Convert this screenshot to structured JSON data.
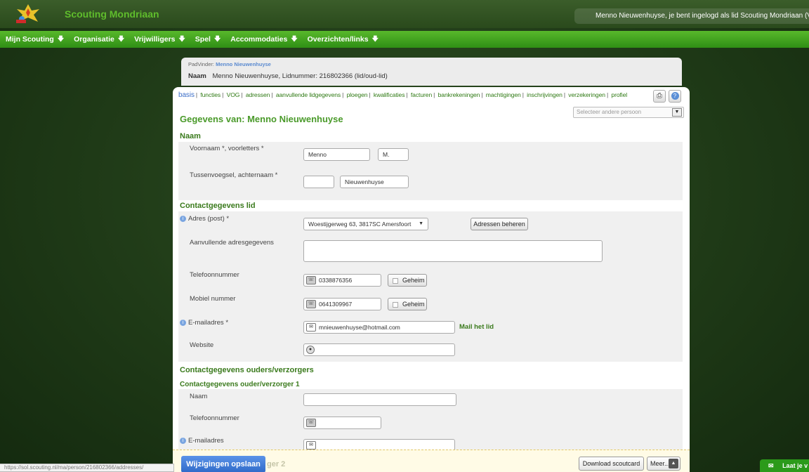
{
  "header": {
    "brand": "Scouting Mondriaan",
    "login_text": "Menno Nieuwenhuyse, je bent ingelogd als lid Scouting Mondriaan (Vrienden"
  },
  "nav": {
    "items": [
      {
        "label": "Mijn Scouting"
      },
      {
        "label": "Organisatie"
      },
      {
        "label": "Vrijwilligers"
      },
      {
        "label": "Spel"
      },
      {
        "label": "Accommodaties"
      },
      {
        "label": "Overzichten/links"
      }
    ]
  },
  "person": {
    "padvinder_label": "PadVinder:",
    "padvinder_name": "Menno Nieuwenhuyse",
    "naam_label": "Naam",
    "naam_value": "Menno Nieuwenhuyse, Lidnummer: 216802366 (lid/oud-lid)"
  },
  "tabs": [
    "basis",
    "functies",
    "VOG",
    "adressen",
    "aanvullende lidgegevens",
    "ploegen",
    "kwalificaties",
    "facturen",
    "bankrekeningen",
    "machtigingen",
    "inschrijvingen",
    "verzekeringen",
    "profiel"
  ],
  "page": {
    "title": "Gegevens van: Menno Nieuwenhuyse",
    "select_other_placeholder": "Selecteer andere persoon"
  },
  "naam_section": {
    "title": "Naam",
    "voornaam_label": "Voornaam *, voorletters *",
    "voornaam_value": "Menno",
    "voorletters_value": "M.",
    "achternaam_label": "Tussenvoegsel, achternaam *",
    "tussenvoegsel_value": "",
    "achternaam_value": "Nieuwenhuyse"
  },
  "contact_section": {
    "title": "Contactgegevens lid",
    "adres_label": "Adres (post) *",
    "adres_value": "Woestijgerweg 63, 3817SC Amersfoort",
    "adressen_button": "Adressen beheren",
    "aanvullend_label": "Aanvullende adresgegevens",
    "telefoon_label": "Telefoonnummer",
    "telefoon_value": "0338876356",
    "mobiel_label": "Mobiel nummer",
    "mobiel_value": "0641309967",
    "geheim_label": "Geheim",
    "email_label": "E-mailadres *",
    "email_value": "mnieuwenhuyse@hotmail.com",
    "mail_link": "Mail het lid",
    "website_label": "Website"
  },
  "parents_section": {
    "title": "Contactgegevens ouders/verzorgers",
    "ouder1_title": "Contactgegevens ouder/verzorger 1",
    "naam_label": "Naam",
    "telefoon_label": "Telefoonnummer",
    "email_label": "E-mailadres",
    "ouder2_partial": "ger 2"
  },
  "footer": {
    "save_button": "Wijzigingen opslaan",
    "scoutcard_button": "Download scoutcard",
    "meer_button": "Meer...",
    "status_url": "https://sol.scouting.nl/ma/person/216802366/addresses/",
    "feedback": "Laat je v"
  },
  "colors": {
    "brand_green": "#5fbd2c",
    "nav_green": "#3fa11d",
    "section_green": "#3a7a1c",
    "save_blue": "#3f7ad6"
  }
}
